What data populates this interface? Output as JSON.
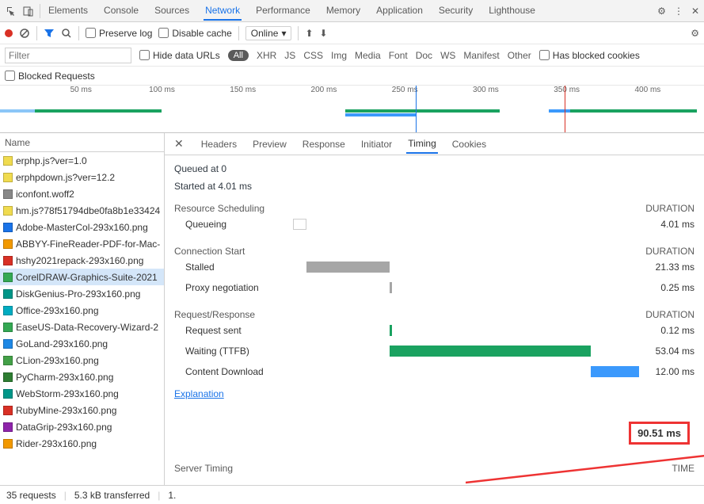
{
  "topbar": {
    "tabs": [
      "Elements",
      "Console",
      "Sources",
      "Network",
      "Performance",
      "Memory",
      "Application",
      "Security",
      "Lighthouse"
    ],
    "activeTab": "Network"
  },
  "toolbar": {
    "preserve_log": "Preserve log",
    "disable_cache": "Disable cache",
    "throttle": "Online"
  },
  "filterbar": {
    "placeholder": "Filter",
    "hide_data_urls": "Hide data URLs",
    "types": [
      "All",
      "XHR",
      "JS",
      "CSS",
      "Img",
      "Media",
      "Font",
      "Doc",
      "WS",
      "Manifest",
      "Other"
    ],
    "has_blocked": "Has blocked cookies"
  },
  "blocked_requests": "Blocked Requests",
  "overview": {
    "ticks": [
      "50 ms",
      "100 ms",
      "150 ms",
      "200 ms",
      "250 ms",
      "300 ms",
      "350 ms",
      "400 ms"
    ]
  },
  "name_header": "Name",
  "files": [
    {
      "name": "erphp.js?ver=1.0",
      "icon": "js"
    },
    {
      "name": "erphpdown.js?ver=12.2",
      "icon": "js"
    },
    {
      "name": "iconfont.woff2",
      "icon": "font"
    },
    {
      "name": "hm.js?78f51794dbe0fa8b1e33424",
      "icon": "js"
    },
    {
      "name": "Adobe-MasterCol-293x160.png",
      "icon": "img-b"
    },
    {
      "name": "ABBYY-FineReader-PDF-for-Mac-",
      "icon": "img-o"
    },
    {
      "name": "hshy2021repack-293x160.png",
      "icon": "img-r"
    },
    {
      "name": "CorelDRAW-Graphics-Suite-2021",
      "icon": "img",
      "selected": true
    },
    {
      "name": "DiskGenius-Pro-293x160.png",
      "icon": "img-t"
    },
    {
      "name": "Office-293x160.png",
      "icon": "img-c"
    },
    {
      "name": "EaseUS-Data-Recovery-Wizard-2",
      "icon": "img"
    },
    {
      "name": "GoLand-293x160.png",
      "icon": "img-bl"
    },
    {
      "name": "CLion-293x160.png",
      "icon": "img-g"
    },
    {
      "name": "PyCharm-293x160.png",
      "icon": "img-g2"
    },
    {
      "name": "WebStorm-293x160.png",
      "icon": "img-t"
    },
    {
      "name": "RubyMine-293x160.png",
      "icon": "img-r"
    },
    {
      "name": "DataGrip-293x160.png",
      "icon": "img-p"
    },
    {
      "name": "Rider-293x160.png",
      "icon": "img-o"
    }
  ],
  "detail_tabs": [
    "Headers",
    "Preview",
    "Response",
    "Initiator",
    "Timing",
    "Cookies"
  ],
  "detail_active": "Timing",
  "timing": {
    "queued_at": "Queued at 0",
    "started_at": "Started at 4.01 ms",
    "scheduling_title": "Resource Scheduling",
    "duration_label": "DURATION",
    "queueing": "Queueing",
    "queueing_dur": "4.01 ms",
    "connection_title": "Connection Start",
    "stalled": "Stalled",
    "stalled_dur": "21.33 ms",
    "proxy": "Proxy negotiation",
    "proxy_dur": "0.25 ms",
    "rr_title": "Request/Response",
    "request_sent": "Request sent",
    "request_sent_dur": "0.12 ms",
    "waiting": "Waiting (TTFB)",
    "waiting_dur": "53.04 ms",
    "content_dl": "Content Download",
    "content_dl_dur": "12.00 ms",
    "explanation": "Explanation",
    "total": "90.51 ms",
    "server_timing": "Server Timing",
    "time_label": "TIME"
  },
  "status": {
    "requests": "35 requests",
    "transferred": "5.3 kB transferred",
    "more": "1."
  },
  "colors": {
    "queueing": "#ffffff",
    "stalled": "#a6a6a6",
    "waiting": "#1aa260",
    "content": "#3b99fc"
  }
}
